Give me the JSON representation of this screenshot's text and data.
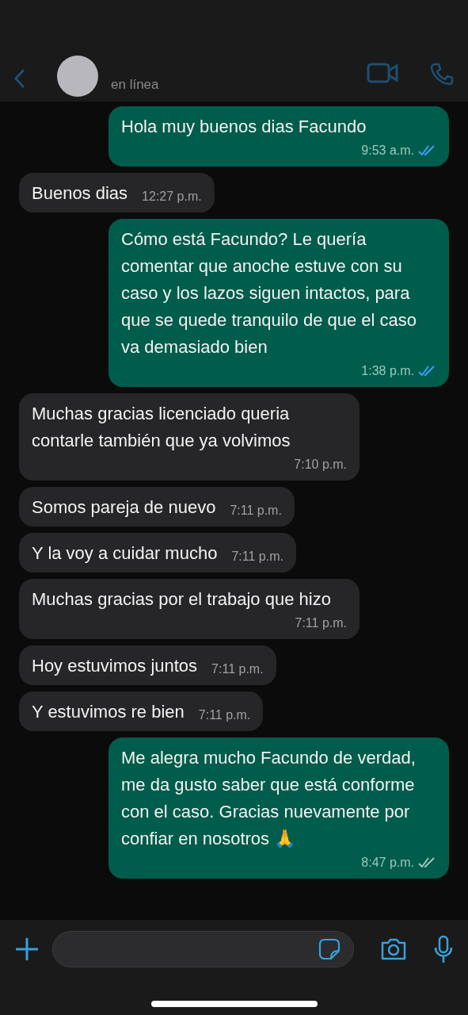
{
  "header": {
    "status": "en línea"
  },
  "messages": [
    {
      "kind": "outgoing",
      "text": "Hola muy buenos dias Facundo",
      "time": "9:53 a.m.",
      "read": true
    },
    {
      "kind": "incoming",
      "text": "Buenos dias",
      "time": "12:27 p.m."
    },
    {
      "kind": "outgoing",
      "text": "Cómo está Facundo? Le quería comentar que anoche estuve con su caso y los lazos siguen intactos, para que se quede tranquilo de que el caso va demasiado bien",
      "time": "1:38 p.m.",
      "read": true
    },
    {
      "kind": "incoming",
      "text": "Muchas gracias licenciado queria contarle también que ya volvimos",
      "time": "7:10 p.m."
    },
    {
      "kind": "incoming",
      "text": "Somos pareja de nuevo",
      "time": "7:11 p.m."
    },
    {
      "kind": "incoming",
      "text": "Y la voy a cuidar mucho",
      "time": "7:11 p.m."
    },
    {
      "kind": "incoming",
      "text": "Muchas gracias por el trabajo que hizo",
      "time": "7:11 p.m."
    },
    {
      "kind": "incoming",
      "text": "Hoy estuvimos juntos",
      "time": "7:11 p.m."
    },
    {
      "kind": "incoming",
      "text": "Y estuvimos re bien",
      "time": "7:11 p.m."
    },
    {
      "kind": "outgoing",
      "text": "Me alegra mucho Facundo de verdad, me da gusto saber que está conforme con el caso. Gracias nuevamente por confiar en nosotros 🙏",
      "time": "8:47 p.m.",
      "read": false
    }
  ]
}
